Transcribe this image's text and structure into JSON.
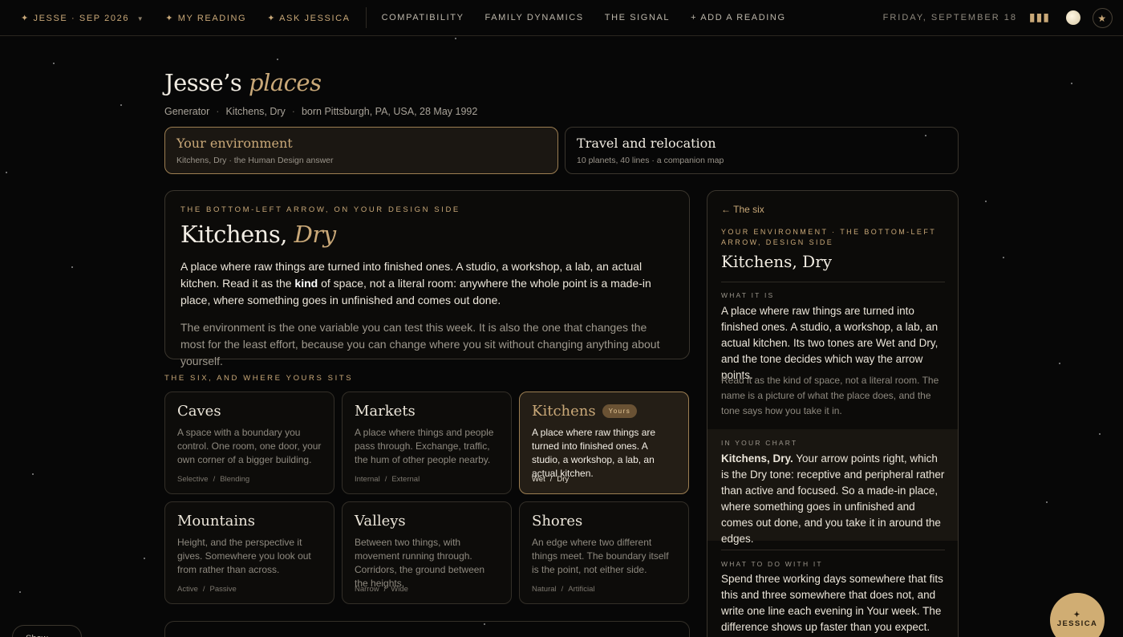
{
  "topbar": {
    "profile": "Jesse · Sep 2026",
    "my_reading": "My Reading",
    "ask": "Ask Jessica",
    "links": [
      "Compatibility",
      "Family Dynamics",
      "The Signal",
      "+ Add a Reading"
    ],
    "date": "Friday, September 18"
  },
  "header": {
    "title_name": "Jesse’s",
    "title_em": "places",
    "type": "Generator",
    "environment": "Kitchens, Dry",
    "born": "born Pittsburgh, PA, USA, 28 May 1992"
  },
  "tabs": [
    {
      "title": "Your environment",
      "sub": "Kitchens, Dry · the Human Design answer"
    },
    {
      "title": "Travel and relocation",
      "sub": "10 planets, 40 lines · a companion map"
    }
  ],
  "main": {
    "eyebrow": "The bottom-left arrow, on your Design side",
    "title_a": "Kitchens,",
    "title_b": "Dry",
    "p1_a": "A place where raw things are turned into finished ones. A studio, a workshop, a lab, an actual kitchen. Read it as the ",
    "p1_b": "kind",
    "p1_c": " of space, not a literal room: anywhere the whole point is a made-in place, where something goes in unfinished and comes out done.",
    "p2": "The environment is the one variable you can test this week. It is also the one that changes the most for the least effort, because you can change where you sit without changing anything about yourself."
  },
  "six_label": "The six, and where yours sits",
  "six": [
    {
      "name": "Caves",
      "desc": "A space with a boundary you control. One room, one door, your own corner of a bigger building.",
      "a": "Selective",
      "b": "Blending"
    },
    {
      "name": "Markets",
      "desc": "A place where things and people pass through. Exchange, traffic, the hum of other people nearby.",
      "a": "Internal",
      "b": "External"
    },
    {
      "name": "Kitchens",
      "badge": "Yours",
      "desc": "A place where raw things are turned into finished ones. A studio, a workshop, a lab, an actual kitchen.",
      "a": "Wet",
      "b": "Dry"
    },
    {
      "name": "Mountains",
      "desc": "Height, and the perspective it gives. Somewhere you look out from rather than across.",
      "a": "Active",
      "b": "Passive"
    },
    {
      "name": "Valleys",
      "desc": "Between two things, with movement running through. Corridors, the ground between the heights.",
      "a": "Narrow",
      "b": "Wide"
    },
    {
      "name": "Shores",
      "desc": "An edge where two different things meet. The boundary itself is the point, not either side.",
      "a": "Natural",
      "b": "Artificial"
    }
  ],
  "side": {
    "back": "← The six",
    "eyebrow": "Your environment · the bottom-left arrow, Design side",
    "title": "Kitchens, Dry",
    "what_label": "What it is",
    "what": "A place where raw things are turned into finished ones. A studio, a workshop, a lab, an actual kitchen. Its two tones are Wet and Dry, and the tone decides which way the arrow points.",
    "what_dim": "Read it as the kind of space, not a literal room. The name is a picture of what the place does, and the tone says how you take it in.",
    "chart_label": "In your chart",
    "chart_b": "Kitchens, Dry.",
    "chart": " Your arrow points right, which is the Dry tone: receptive and peripheral rather than active and focused. So a made-in place, where something goes in unfinished and comes out done, and you take it in around the edges.",
    "todo_label": "What to do with it",
    "todo": "Spend three working days somewhere that fits this and three somewhere that does not, and write one line each evening in Your week. The difference shows up faster than you expect."
  },
  "fab": "Jessica",
  "pill": "Show today",
  "icons": {
    "dots": "menu-dots-icon",
    "moon": "moon-phase-icon",
    "star": "star-icon"
  }
}
